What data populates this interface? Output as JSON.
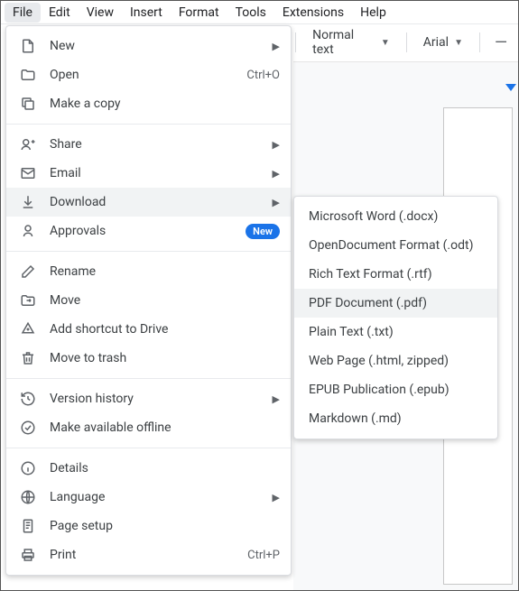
{
  "menubar": {
    "items": [
      "File",
      "Edit",
      "View",
      "Insert",
      "Format",
      "Tools",
      "Extensions",
      "Help"
    ],
    "active_index": 0
  },
  "toolbar": {
    "style_label": "Normal text",
    "font_label": "Arial"
  },
  "file_menu": {
    "new": "New",
    "open": "Open",
    "open_shortcut": "Ctrl+O",
    "make_copy": "Make a copy",
    "share": "Share",
    "email": "Email",
    "download": "Download",
    "approvals": "Approvals",
    "approvals_badge": "New",
    "rename": "Rename",
    "move": "Move",
    "add_shortcut": "Add shortcut to Drive",
    "move_trash": "Move to trash",
    "version_history": "Version history",
    "make_offline": "Make available offline",
    "details": "Details",
    "language": "Language",
    "page_setup": "Page setup",
    "print": "Print",
    "print_shortcut": "Ctrl+P"
  },
  "download_submenu": {
    "items": [
      "Microsoft Word (.docx)",
      "OpenDocument Format (.odt)",
      "Rich Text Format (.rtf)",
      "PDF Document (.pdf)",
      "Plain Text (.txt)",
      "Web Page (.html, zipped)",
      "EPUB Publication (.epub)",
      "Markdown (.md)"
    ],
    "hover_index": 3
  }
}
